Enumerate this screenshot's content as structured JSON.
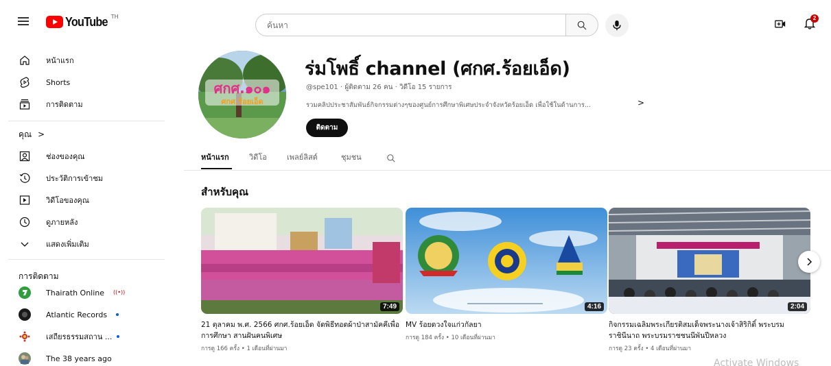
{
  "header": {
    "logo_text": "YouTube",
    "country_code": "TH",
    "search_placeholder": "ค้นหา",
    "notification_count": "2"
  },
  "sidebar": {
    "main_items": [
      {
        "label": "หน้าแรก",
        "icon": "home-icon"
      },
      {
        "label": "Shorts",
        "icon": "shorts-icon"
      },
      {
        "label": "การติดตาม",
        "icon": "subscriptions-icon"
      }
    ],
    "you_heading": "คุณ",
    "you_items": [
      {
        "label": "ช่องของคุณ",
        "icon": "your-channel-icon"
      },
      {
        "label": "ประวัติการเข้าชม",
        "icon": "history-icon"
      },
      {
        "label": "วิดีโอของคุณ",
        "icon": "your-videos-icon"
      },
      {
        "label": "ดูภายหลัง",
        "icon": "watch-later-icon"
      },
      {
        "label": "แสดงเพิ่มเติม",
        "icon": "chevron-down-icon"
      }
    ],
    "subscriptions_heading": "การติดตาม",
    "subscriptions": [
      {
        "label": "Thairath Online",
        "status": "live",
        "color": "#2e9e3e"
      },
      {
        "label": "Atlantic Records",
        "status": "new",
        "color": "#1a1a1a"
      },
      {
        "label": "เสถียรธรรมสถาน ...",
        "status": "new",
        "color": "#c0392b"
      },
      {
        "label": "The 38 years ago",
        "status": "",
        "color": "#7a8a70"
      }
    ]
  },
  "channel": {
    "name": "ร่มโพธิ์ channel (ศกศ.ร้อยเอ็ด)",
    "meta": "@spe101 · ผู้ติดตาม 26 คน · วิดีโอ 15 รายการ",
    "description": "รวมคลิปประชาสัมพันธ์กิจกรรมต่างๆของศูนย์การศึกษาพิเศษประจำจังหวัดร้อยเอ็ด เพื่อใช้ในด้านการ...",
    "description_more": ">",
    "subscribe_label": "ติดตาม",
    "avatar_text": "ศกศ.ร้อยเอ็ด"
  },
  "tabs": [
    {
      "label": "หน้าแรก",
      "active": true
    },
    {
      "label": "วิดีโอ",
      "active": false
    },
    {
      "label": "เพลย์ลิสต์",
      "active": false
    },
    {
      "label": "ชุมชน",
      "active": false
    }
  ],
  "section_title": "สำหรับคุณ",
  "videos": [
    {
      "title": "21 ตุลาคม พ.ศ. 2566 ศกศ.ร้อยเอ็ด จัดพิธีทอดผ้าป่าสามัคคีเพื่อการศึกษา สานฝันคนพิเศษ",
      "meta": "การดู 166 ครั้ง • 1 เดือนที่ผ่านมา",
      "duration": "7:49"
    },
    {
      "title": "MV ร้อยดวงใจแก่วกัลยา",
      "meta": "การดู 184 ครั้ง • 10 เดือนที่ผ่านมา",
      "duration": "4:16"
    },
    {
      "title": "กิจกรรมเฉลิมพระเกียรติสมเด็จพระนางเจ้าสิริกิติ์ พระบรมราชินีนาถ พระบรมราชชนนีพันปีหลวง",
      "meta": "การดู 23 ครั้ง • 4 เดือนที่ผ่านมา",
      "duration": "2:04"
    }
  ],
  "watermark": "Activate Windows"
}
